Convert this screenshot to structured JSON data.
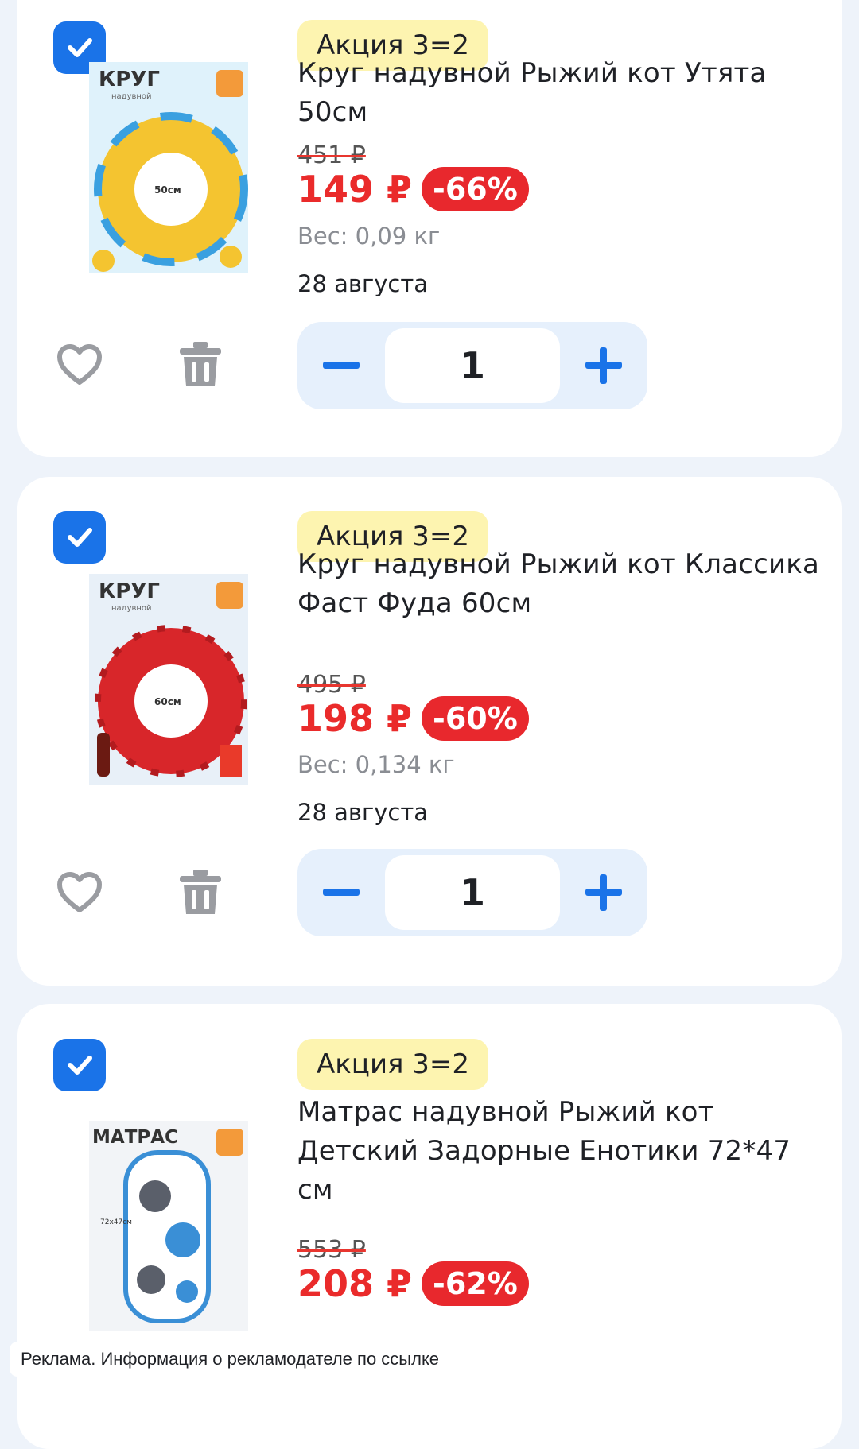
{
  "items": [
    {
      "promo": "Акция 3=2",
      "title": "Круг надувной Рыжий кот Утята 50см",
      "old_price": "451 ₽",
      "price": "149 ₽",
      "discount": "-66%",
      "weight": "Вес: 0,09 кг",
      "delivery": "28 августа",
      "quantity": "1",
      "checked": true,
      "image": {
        "brand": "КРУГ",
        "sub": "надувной",
        "size": "50см",
        "accent": "#f4c430"
      }
    },
    {
      "promo": "Акция 3=2",
      "title": "Круг надувной Рыжий кот Классика Фаст Фуда 60см",
      "old_price": "495 ₽",
      "price": "198 ₽",
      "discount": "-60%",
      "weight": "Вес: 0,134 кг",
      "delivery": "28 августа",
      "quantity": "1",
      "checked": true,
      "image": {
        "brand": "КРУГ",
        "sub": "надувной",
        "size": "60см",
        "accent": "#d8262a"
      }
    },
    {
      "promo": "Акция 3=2",
      "title": "Матрас надувной Рыжий кот Детский Задорные Енотики 72*47 см",
      "old_price": "553 ₽",
      "price": "208 ₽",
      "discount": "-62%",
      "checked": true,
      "image": {
        "brand": "МАТРАС",
        "sub": "",
        "size": "72x47см",
        "accent": "#3a8fd6"
      }
    }
  ],
  "ad_notice": "Реклама. Информация о рекламодателе по ссылке",
  "colors": {
    "accent": "#1a73e8",
    "sale": "#e8282d",
    "promo_bg": "#fdf4b0",
    "page_bg": "#eef3fa"
  },
  "icons": [
    "checkbox-checked-icon",
    "heart-icon",
    "trash-icon",
    "minus-icon",
    "plus-icon"
  ]
}
